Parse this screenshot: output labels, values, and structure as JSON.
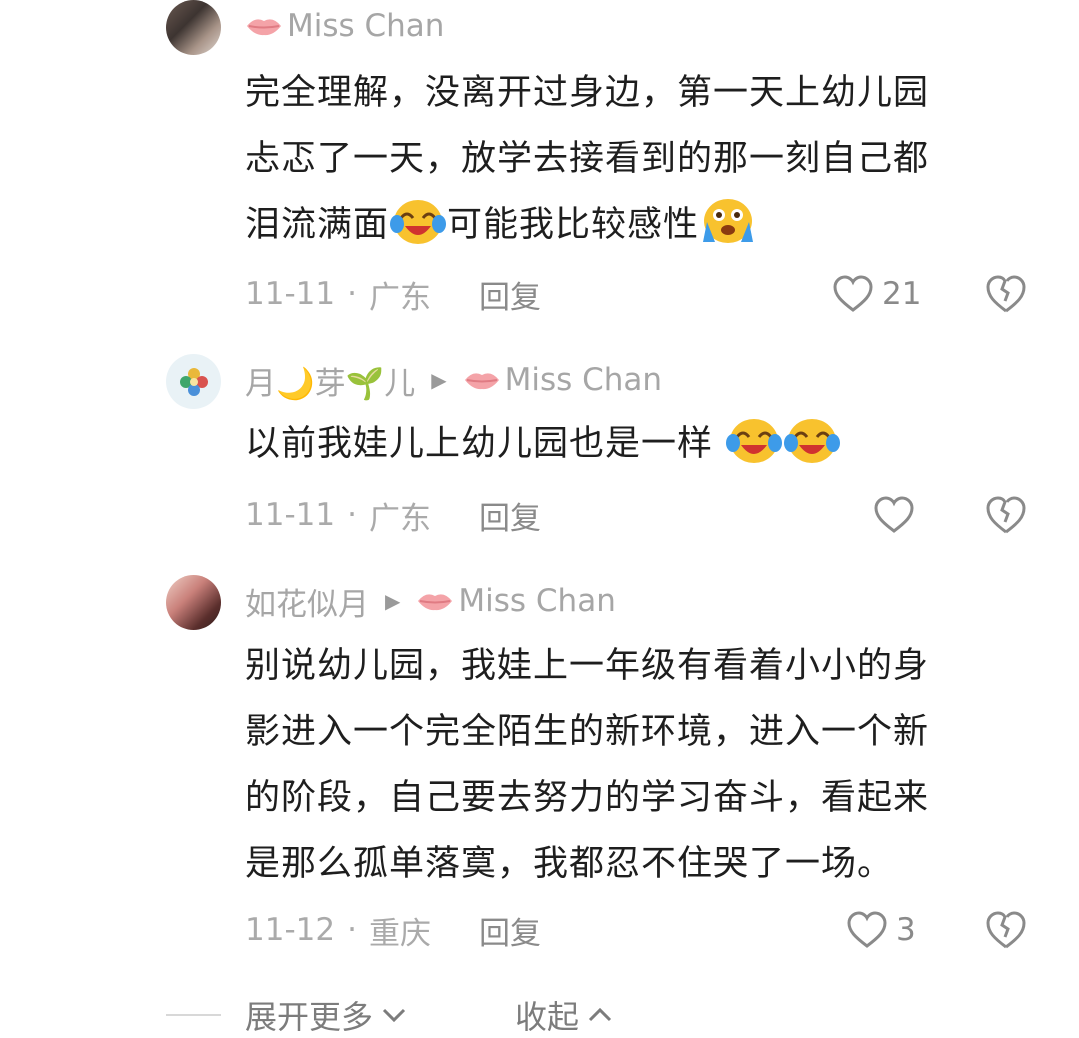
{
  "comments": [
    {
      "author": "Miss Chan",
      "author_icon": "lips-emoji",
      "lines": [
        "完全理解，没离开过身边，第一天上幼儿园",
        "忐忑了一天，放学去接看到的那一刻自己都"
      ],
      "line3_a": "泪流满面",
      "line3_b": "可能我比较感性",
      "emoji_a": "tears-of-joy-emoji",
      "emoji_b": "loudly-crying-emoji",
      "date": "11-11",
      "separator": "·",
      "location": "广东",
      "reply_label": "回复",
      "likes": "21"
    },
    {
      "author": "月🌙芽🌱儿",
      "reply_to": "Miss Chan",
      "text": "以前我娃儿上幼儿园也是一样",
      "emoji": "tears-of-joy-emoji",
      "date": "11-11",
      "separator": "·",
      "location": "广东",
      "reply_label": "回复",
      "likes": ""
    },
    {
      "author": "如花似月",
      "reply_to": "Miss Chan",
      "lines": [
        "别说幼儿园，我娃上一年级有看着小小的身",
        "影进入一个完全陌生的新环境，进入一个新",
        "的阶段，自己要去努力的学习奋斗，看起来",
        "是那么孤单落寞，我都忍不住哭了一场。"
      ],
      "date": "11-12",
      "separator": "·",
      "location": "重庆",
      "reply_label": "回复",
      "likes": "3"
    }
  ],
  "footer": {
    "expand_label": "展开更多",
    "collapse_label": "收起"
  },
  "colors": {
    "text": "#1e1e1e",
    "meta": "#a6a6a6",
    "icon": "#8a8a8a"
  }
}
